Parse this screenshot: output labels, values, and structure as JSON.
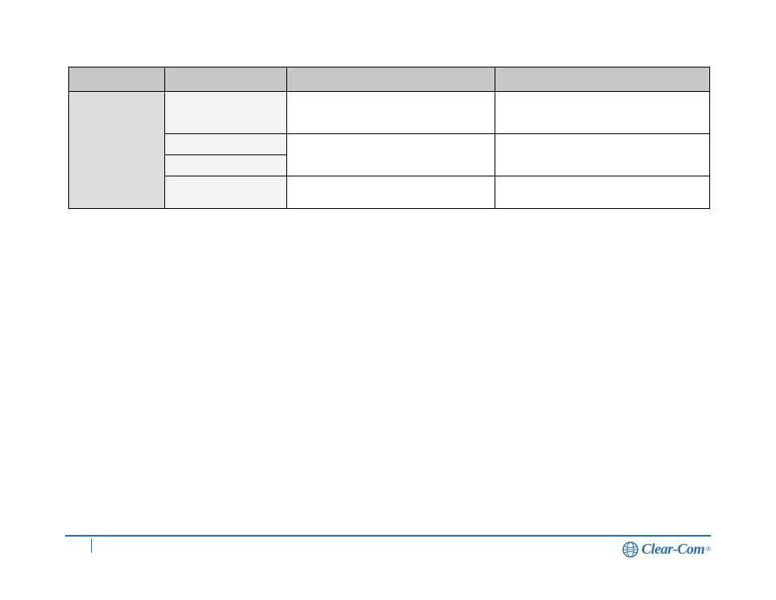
{
  "table": {
    "headers": [
      "",
      "",
      "",
      ""
    ],
    "rowgroup_label": "",
    "rows": [
      {
        "sub": "",
        "c3": "",
        "c4": ""
      },
      {
        "sub": "",
        "c3m": "",
        "c4m": ""
      },
      {
        "sub": ""
      },
      {
        "sub": "",
        "c3": "",
        "c4": ""
      }
    ]
  },
  "footer": {
    "page_number": "",
    "doc_title": ""
  },
  "brand": {
    "name": "Clear-Com",
    "registered": "®"
  }
}
